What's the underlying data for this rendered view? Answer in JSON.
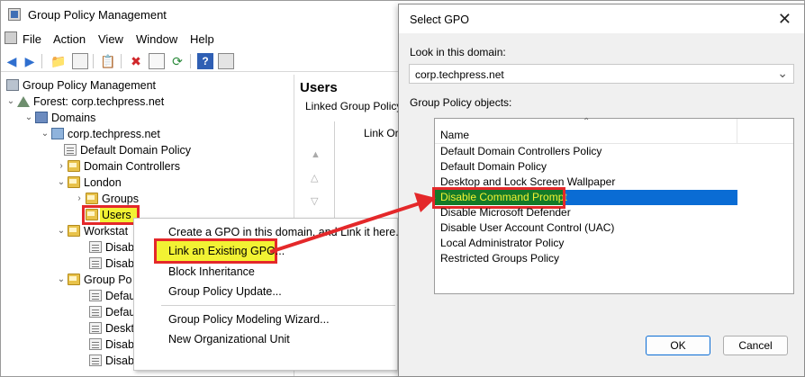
{
  "colors": {
    "accent": "#e4282a",
    "highlight": "#f2f233",
    "selection": "#0a6cd4",
    "green_select": "#137a28"
  },
  "main_window": {
    "title": "Group Policy Management",
    "menu": [
      "File",
      "Action",
      "View",
      "Window",
      "Help"
    ]
  },
  "toolbar_icons": [
    "back-icon",
    "forward-icon",
    "up-folder-icon",
    "show-hide-tree-icon",
    "properties-icon",
    "delete-icon",
    "export-icon",
    "refresh-icon",
    "help-icon",
    "console-icon"
  ],
  "tree": {
    "root": "Group Policy Management",
    "forest": "Forest: corp.techpress.net",
    "domains": "Domains",
    "domain": "corp.techpress.net",
    "default_domain_policy": "Default Domain Policy",
    "domain_controllers": "Domain Controllers",
    "london": "London",
    "groups": "Groups",
    "users": "Users",
    "workstations": "Workstat",
    "ws_child_1": "Disab",
    "ws_child_2": "Disab",
    "group_policy_objects": "Group Po",
    "gpo_child_1": "Defau",
    "gpo_child_2": "Defau",
    "gpo_child_3": "Deskt",
    "gpo_child_4": "Disab",
    "gpo_child_5": "Disab"
  },
  "right_pane": {
    "title": "Users",
    "tab": "Linked Group Policy O",
    "column": "Link Or"
  },
  "context_menu": {
    "create_gpo": "Create a GPO in this domain, and Link it here...",
    "link_existing": "Link an Existing GPO...",
    "block_inheritance": "Block Inheritance",
    "gp_update": "Group Policy Update...",
    "modeling_wizard": "Group Policy Modeling Wizard...",
    "new_ou": "New Organizational Unit"
  },
  "dialog": {
    "title": "Select GPO",
    "look_in_label": "Look in this domain:",
    "domain_value": "corp.techpress.net",
    "objects_label": "Group Policy objects:",
    "column_name": "Name",
    "gpos": [
      "Default Domain Controllers Policy",
      "Default Domain Policy",
      "Desktop and Lock Screen Wallpaper",
      "Disable Command Prompt",
      "Disable Microsoft Defender",
      "Disable User Account Control (UAC)",
      "Local Administrator Policy",
      "Restricted Groups Policy"
    ],
    "selected_index": 3,
    "ok": "OK",
    "cancel": "Cancel"
  }
}
